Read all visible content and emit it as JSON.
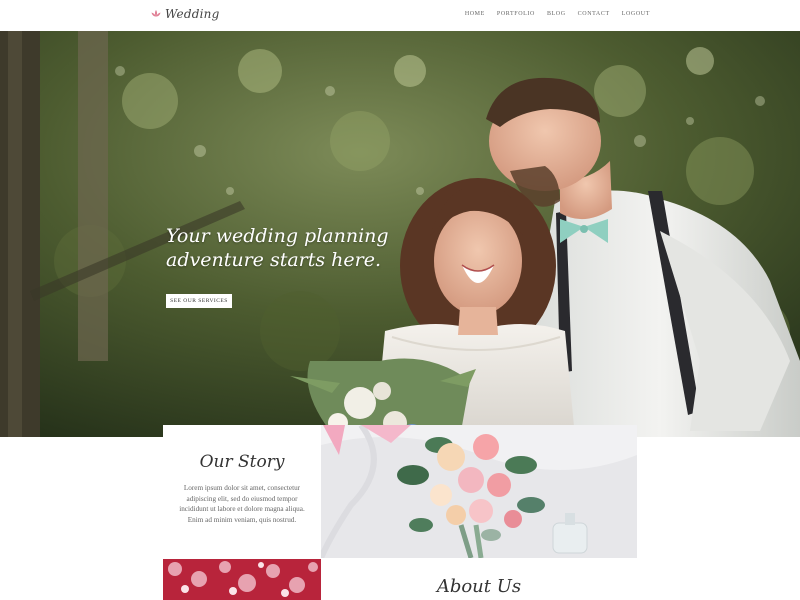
{
  "header": {
    "logo_text": "Wedding",
    "nav": [
      "HOME",
      "PORTFOLIO",
      "BLOG",
      "CONTACT",
      "LOGOUT"
    ]
  },
  "hero": {
    "title": "Your wedding planning adventure starts here.",
    "button_label": "SEE OUR SERVICES"
  },
  "story": {
    "title": "Our Story",
    "text": "Lorem ipsum dolor sit amet, consectetur adipiscing elit, sed do eiusmod tempor incididunt ut labore et dolore magna aliqua. Enim ad minim veniam, quis nostrud."
  },
  "about": {
    "title": "About Us"
  },
  "colors": {
    "brand_pink": "#e07f95",
    "text_dark": "#333333",
    "text_muted": "#666666"
  }
}
